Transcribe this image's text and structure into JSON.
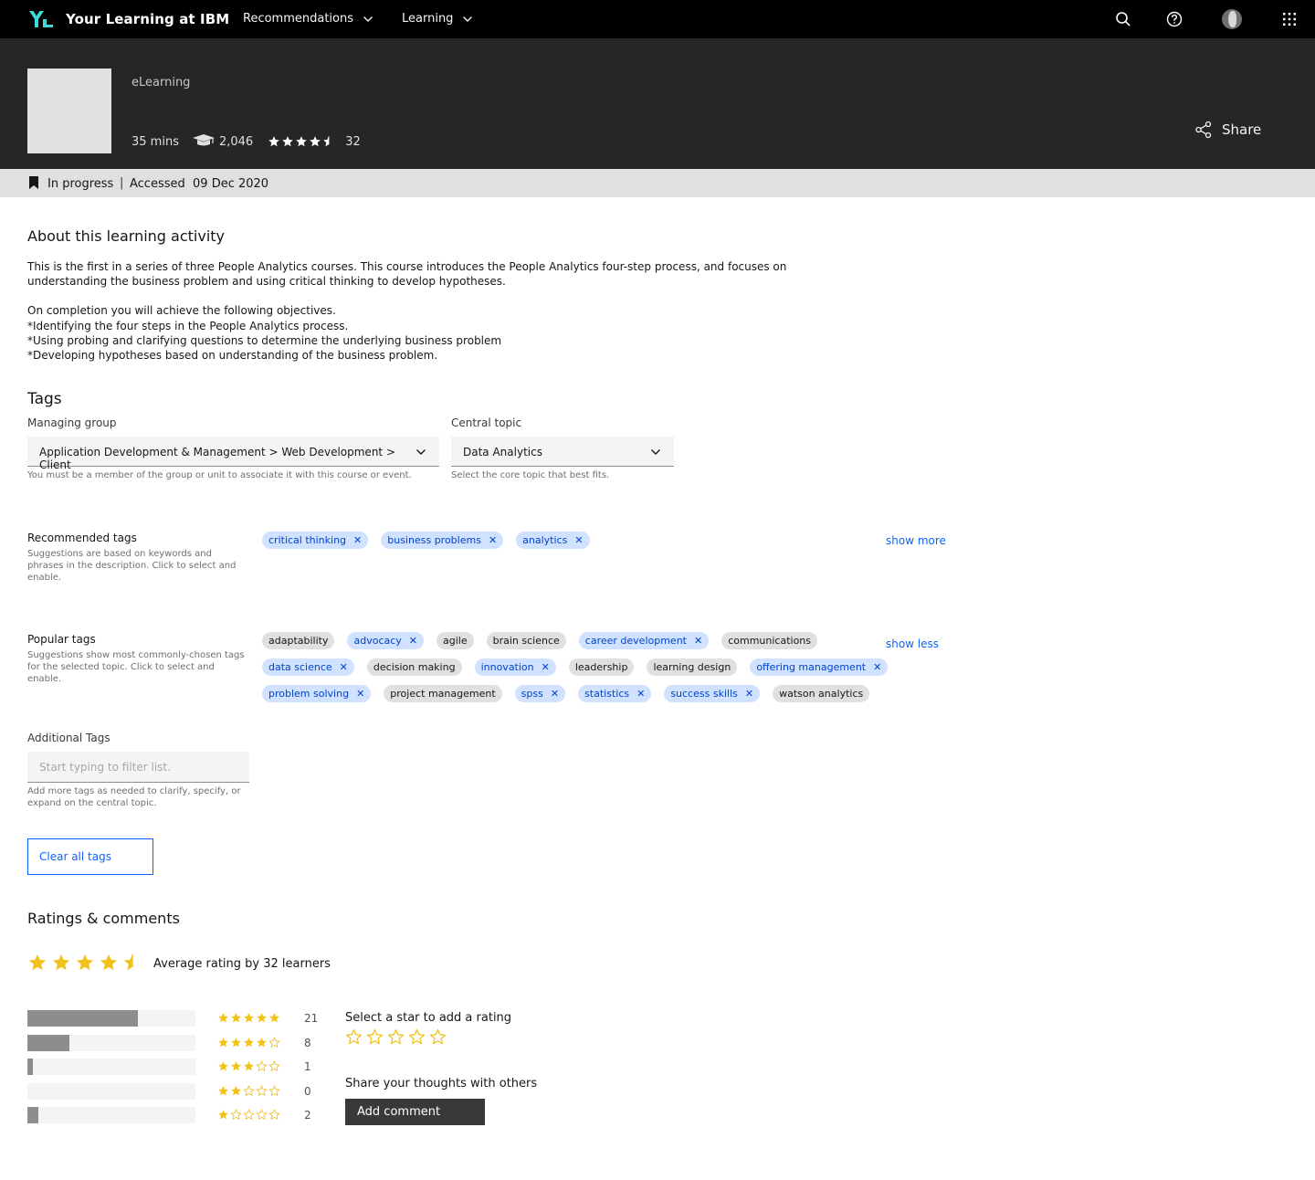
{
  "header": {
    "brand": "Your Learning at IBM",
    "menus": [
      {
        "label": "Recommendations"
      },
      {
        "label": "Learning"
      }
    ],
    "icons": [
      "logo-icon",
      "search-icon",
      "help-icon",
      "avatar",
      "apps-icon"
    ]
  },
  "hero": {
    "activity_type": "eLearning",
    "duration": "35 mins",
    "learners": "2,046",
    "rating": 4.5,
    "rating_count": "32",
    "share_label": "Share"
  },
  "status": {
    "state": "In progress",
    "separator": "|",
    "accessed": "Accessed  09 Dec 2020"
  },
  "about": {
    "title": "About this learning activity",
    "paragraph": "This is the first in a series of three People Analytics courses.  This course introduces the People Analytics four-step process, and focuses on understanding the business problem and using critical thinking to develop hypotheses.",
    "objectives_intro": "On completion you will achieve the following objectives.",
    "objectives": [
      "*Identifying the four steps in the People Analytics process.",
      "*Using probing and clarifying questions to determine the underlying business problem",
      "*Developing hypotheses based on understanding of the business problem."
    ]
  },
  "tags": {
    "title": "Tags",
    "managing_group": {
      "label": "Managing group",
      "value": "Application Development & Management > Web Development > Client",
      "helper": "You must be a member of the group or unit to associate it with this course or event."
    },
    "central_topic": {
      "label": "Central topic",
      "value": "Data Analytics",
      "helper": "Select the core topic that best fits."
    },
    "recommended": {
      "label": "Recommended tags",
      "help": "Suggestions are based on keywords and phrases in the description. Click to select and enable.",
      "link": "show more",
      "chips": [
        {
          "label": "critical thinking",
          "selected": true
        },
        {
          "label": "business problems",
          "selected": true
        },
        {
          "label": "analytics",
          "selected": true
        }
      ]
    },
    "popular": {
      "label": "Popular tags",
      "help": "Suggestions show most commonly-chosen tags for the selected topic. Click to select and enable.",
      "link": "show less",
      "rows": [
        [
          {
            "label": "adaptability",
            "selected": false
          },
          {
            "label": "advocacy",
            "selected": true
          },
          {
            "label": "agile",
            "selected": false
          },
          {
            "label": "brain science",
            "selected": false
          },
          {
            "label": "career development",
            "selected": true
          },
          {
            "label": "communications",
            "selected": false
          }
        ],
        [
          {
            "label": "data science",
            "selected": true
          },
          {
            "label": "decision making",
            "selected": false
          },
          {
            "label": "innovation",
            "selected": true
          },
          {
            "label": "leadership",
            "selected": false
          },
          {
            "label": "learning design",
            "selected": false
          },
          {
            "label": "offering management",
            "selected": true
          }
        ],
        [
          {
            "label": "problem solving",
            "selected": true
          },
          {
            "label": "project management",
            "selected": false
          },
          {
            "label": "spss",
            "selected": true
          },
          {
            "label": "statistics",
            "selected": true
          },
          {
            "label": "success skills",
            "selected": true
          },
          {
            "label": "watson analytics",
            "selected": false
          }
        ]
      ]
    },
    "additional": {
      "label": "Additional Tags",
      "placeholder": "Start typing to filter list.",
      "helper": "Add more tags as needed to clarify, specify, or expand on the central topic."
    },
    "clear_label": "Clear all tags"
  },
  "ratings": {
    "title": "Ratings & comments",
    "average": 4.5,
    "average_text": "Average rating by 32 learners",
    "distribution": [
      {
        "stars": 5,
        "count": "21",
        "fraction": 0.656
      },
      {
        "stars": 4,
        "count": "8",
        "fraction": 0.25
      },
      {
        "stars": 3,
        "count": "1",
        "fraction": 0.031
      },
      {
        "stars": 2,
        "count": "0",
        "fraction": 0
      },
      {
        "stars": 1,
        "count": "2",
        "fraction": 0.063
      }
    ],
    "select_label": "Select a star to add a rating",
    "share_label": "Share your thoughts with others",
    "comment_button": "Add comment"
  },
  "colors": {
    "nav_bg": "#000000",
    "hero_bg": "#262626",
    "status_bg": "#e0e0e0",
    "link": "#0f62fe",
    "chip_selected_bg": "#d0e2ff",
    "chip_selected_fg": "#0043ce",
    "star": "#f1c21b",
    "bar_fill": "#8d8d8d",
    "logo": "#3ddbd9"
  }
}
